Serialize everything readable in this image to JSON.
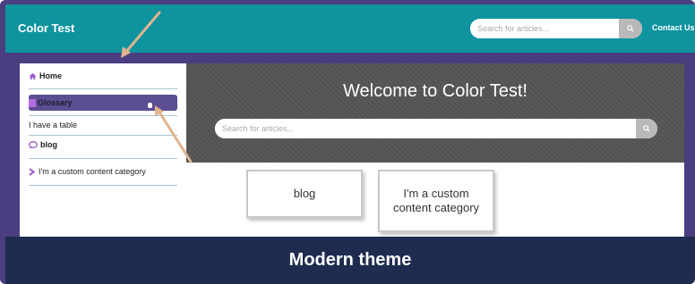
{
  "header": {
    "brand": "Color Test",
    "search_placeholder": "Search for articles...",
    "contact_label": "Contact Us"
  },
  "sidebar": {
    "items": [
      {
        "label": "Home",
        "icon": "home-icon"
      },
      {
        "label": "Glossary",
        "icon": "bookmark-icon"
      },
      {
        "label": "I have a table",
        "icon": ""
      },
      {
        "label": "blog",
        "icon": "chat-icon"
      },
      {
        "label": "I'm a custom content category",
        "icon": "chevron-right-icon"
      }
    ]
  },
  "hero": {
    "title": "Welcome to Color Test!",
    "search_placeholder": "Search for articles..."
  },
  "cards": [
    {
      "label": "blog"
    },
    {
      "label": "I'm a custom content category"
    }
  ],
  "footer": {
    "caption": "Modern theme"
  },
  "colors": {
    "header": "#0e939f",
    "purple": "#4a3d80",
    "active_item": "#5c4e92",
    "hero": "#555555",
    "footer": "#1f2c4f",
    "arrow": "#e0b48e",
    "icon_accent": "#9b59d0"
  }
}
